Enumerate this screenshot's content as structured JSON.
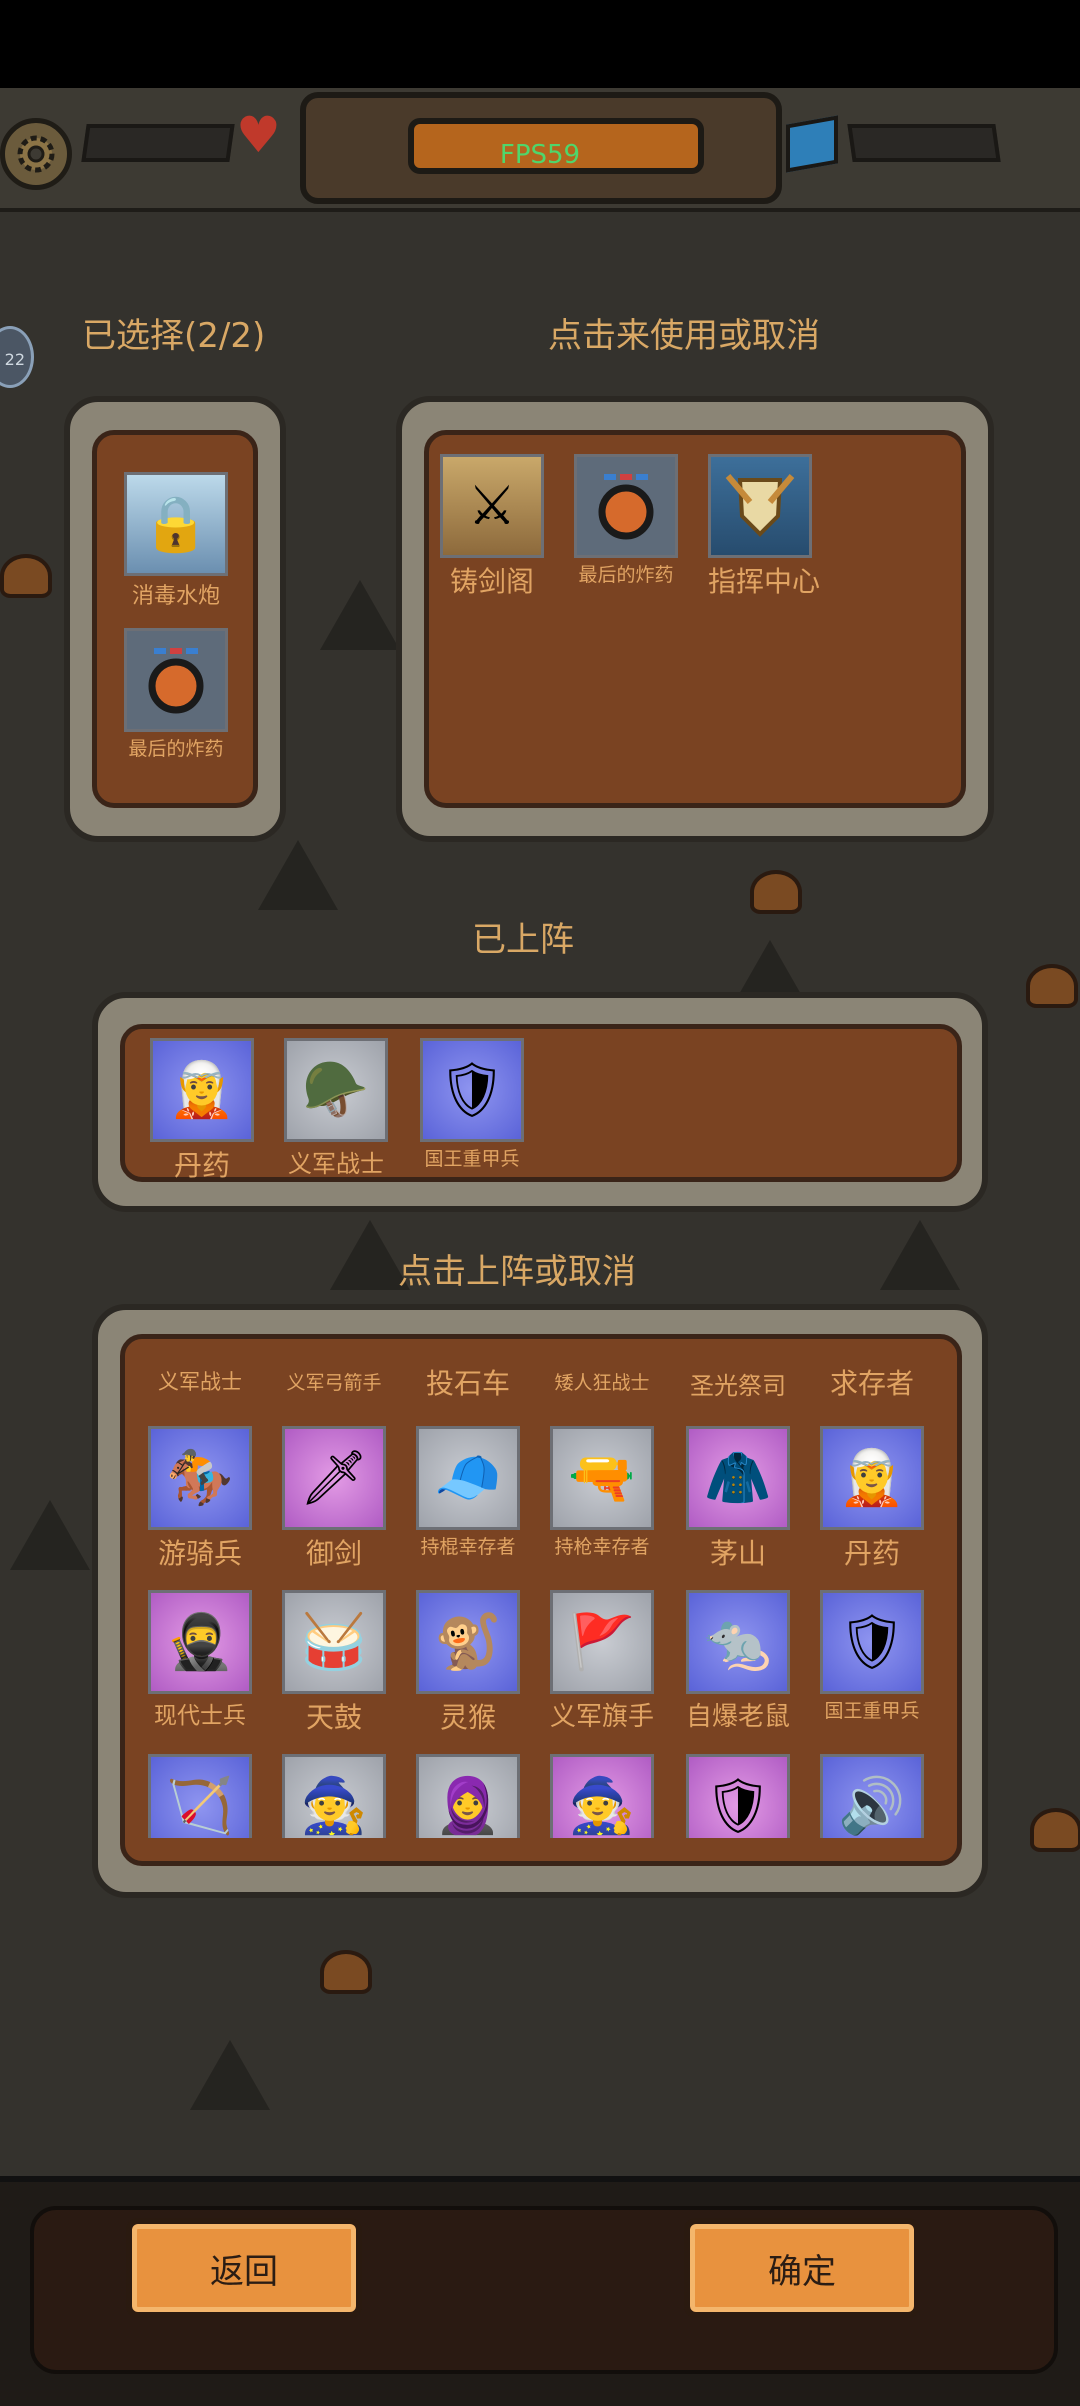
{
  "hud": {
    "fps": "FPS59",
    "side_badge": "22"
  },
  "selected_panel": {
    "title": "已选择(2/2)",
    "items": [
      {
        "label": "消毒水炮",
        "icon": "water-cannon-icon"
      },
      {
        "label": "最后的炸药",
        "icon": "bomb-icon"
      }
    ]
  },
  "available_panel": {
    "title": "点击来使用或取消",
    "items": [
      {
        "label": "铸剑阁",
        "icon": "forge-icon"
      },
      {
        "label": "最后的炸药",
        "icon": "bomb-icon"
      },
      {
        "label": "指挥中心",
        "icon": "command-center-icon"
      }
    ]
  },
  "deployed_panel": {
    "title": "已上阵",
    "items": [
      {
        "label": "丹药",
        "icon": "alchemist-icon"
      },
      {
        "label": "义军战士",
        "icon": "rebel-warrior-icon"
      },
      {
        "label": "国王重甲兵",
        "icon": "royal-heavy-infantry-icon"
      }
    ]
  },
  "roster_panel": {
    "title": "点击上阵或取消",
    "partial_top_row": [
      "义军战士",
      "义军弓箭手",
      "投石车",
      "矮人狂战士",
      "圣光祭司",
      "求存者"
    ],
    "rows": [
      [
        {
          "label": "游骑兵",
          "icon": "mounted-ranger-icon"
        },
        {
          "label": "御剑",
          "icon": "sword-master-icon"
        },
        {
          "label": "持棍幸存者",
          "icon": "club-survivor-icon"
        },
        {
          "label": "持枪幸存者",
          "icon": "gun-survivor-icon"
        },
        {
          "label": "茅山",
          "icon": "maoshan-priest-icon"
        },
        {
          "label": "丹药",
          "icon": "alchemist-icon"
        }
      ],
      [
        {
          "label": "现代士兵",
          "icon": "modern-soldier-icon"
        },
        {
          "label": "天鼓",
          "icon": "drummer-icon"
        },
        {
          "label": "灵猴",
          "icon": "monkey-icon"
        },
        {
          "label": "义军旗手",
          "icon": "flag-bearer-icon"
        },
        {
          "label": "自爆老鼠",
          "icon": "bomb-rat-icon"
        },
        {
          "label": "国王重甲兵",
          "icon": "royal-heavy-infantry-icon"
        }
      ],
      [
        {
          "label": "",
          "icon": "elf-archer-icon"
        },
        {
          "label": "",
          "icon": "grey-wizard-icon"
        },
        {
          "label": "",
          "icon": "hooded-assassin-icon"
        },
        {
          "label": "",
          "icon": "white-wizard-icon"
        },
        {
          "label": "",
          "icon": "frost-knight-icon"
        },
        {
          "label": "",
          "icon": "speaker-icon"
        }
      ]
    ]
  },
  "buttons": {
    "back": "返回",
    "confirm": "确定"
  },
  "colors": {
    "accent_text": "#d9a865",
    "panel_brown": "#7a4322",
    "button_orange": "#e8923e",
    "fps_green": "#4fd66b"
  }
}
